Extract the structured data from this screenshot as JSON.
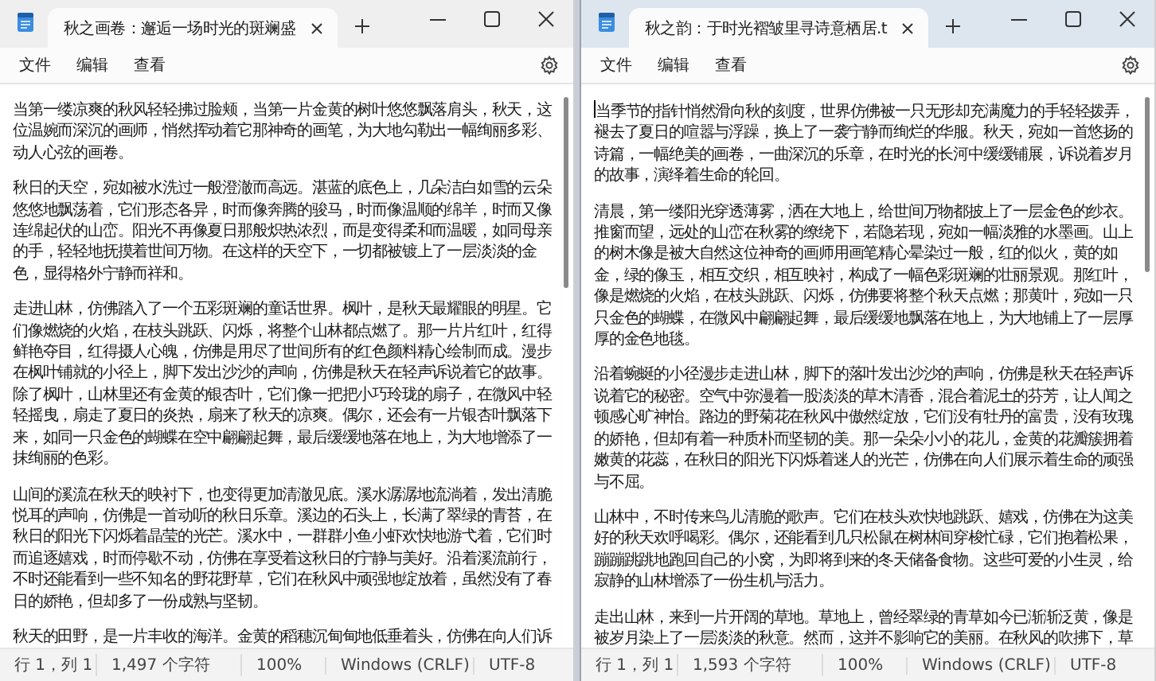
{
  "windows": [
    {
      "focused": false,
      "tab": {
        "title": "秋之画卷：邂逅一场时光的斑斓盛",
        "selected": true
      },
      "menu": [
        "文件",
        "编辑",
        "查看"
      ],
      "paragraphs": [
        "当第一缕凉爽的秋风轻轻拂过脸颊，当第一片金黄的树叶悠悠飘落肩头，秋天，这位温婉而深沉的画师，悄然挥动着它那神奇的画笔，为大地勾勒出一幅绚丽多彩、动人心弦的画卷。",
        "秋日的天空，宛如被水洗过一般澄澈而高远。湛蓝的底色上，几朵洁白如雪的云朵悠悠地飘荡着，它们形态各异，时而像奔腾的骏马，时而像温顺的绵羊，时而又像连绵起伏的山峦。阳光不再像夏日那般炽热浓烈，而是变得柔和而温暖，如同母亲的手，轻轻地抚摸着世间万物。在这样的天空下，一切都被镀上了一层淡淡的金色，显得格外宁静而祥和。",
        "走进山林，仿佛踏入了一个五彩斑斓的童话世界。枫叶，是秋天最耀眼的明星。它们像燃烧的火焰，在枝头跳跃、闪烁，将整个山林都点燃了。那一片片红叶，红得鲜艳夺目，红得摄人心魄，仿佛是用尽了世间所有的红色颜料精心绘制而成。漫步在枫叶铺就的小径上，脚下发出沙沙的声响，仿佛是秋天在轻声诉说着它的故事。除了枫叶，山林里还有金黄的银杏叶，它们像一把把小巧玲珑的扇子，在微风中轻轻摇曳，扇走了夏日的炎热，扇来了秋天的凉爽。偶尔，还会有一片银杏叶飘落下来，如同一只金色的蝴蝶在空中翩翩起舞，最后缓缓地落在地上，为大地增添了一抹绚丽的色彩。",
        "山间的溪流在秋天的映衬下，也变得更加清澈见底。溪水潺潺地流淌着，发出清脆悦耳的声响，仿佛是一首动听的秋日乐章。溪边的石头上，长满了翠绿的青苔，在秋日的阳光下闪烁着晶莹的光芒。溪水中，一群群小鱼小虾欢快地游弋着，它们时而追逐嬉戏，时而停歇不动，仿佛在享受着这秋日的宁静与美好。沿着溪流前行，不时还能看到一些不知名的野花野草，它们在秋风中顽强地绽放着，虽然没有了春日的娇艳，但却多了一份成熟与坚韧。",
        "秋天的田野，是一片丰收的海洋。金黄的稻穗沉甸甸地低垂着头，仿佛在向人们诉"
      ],
      "status": {
        "position": "行 1，列 1",
        "characters": "1,497 个字符",
        "zoom": "100%",
        "line_ending": "Windows (CRLF)",
        "encoding": "UTF-8"
      }
    },
    {
      "focused": true,
      "tab": {
        "title": "秋之韵：于时光褶皱里寻诗意栖居.t",
        "selected": true
      },
      "menu": [
        "文件",
        "编辑",
        "查看"
      ],
      "paragraphs": [
        "当季节的指针悄然滑向秋的刻度，世界仿佛被一只无形却充满魔力的手轻轻拨弄，褪去了夏日的喧嚣与浮躁，换上了一袭宁静而绚烂的华服。秋天，宛如一首悠扬的诗篇，一幅绝美的画卷，一曲深沉的乐章，在时光的长河中缓缓铺展，诉说着岁月的故事，演绎着生命的轮回。",
        "清晨，第一缕阳光穿透薄雾，洒在大地上，给世间万物都披上了一层金色的纱衣。推窗而望，远处的山峦在秋雾的缭绕下，若隐若现，宛如一幅淡雅的水墨画。山上的树木像是被大自然这位神奇的画师用画笔精心晕染过一般，红的似火，黄的如金，绿的像玉，相互交织，相互映衬，构成了一幅色彩斑斓的壮丽景观。那红叶，像是燃烧的火焰，在枝头跳跃、闪烁，仿佛要将整个秋天点燃；那黄叶，宛如一只只金色的蝴蝶，在微风中翩翩起舞，最后缓缓地飘落在地上，为大地铺上了一层厚厚的金色地毯。",
        "沿着蜿蜒的小径漫步走进山林，脚下的落叶发出沙沙的声响，仿佛是秋天在轻声诉说着它的秘密。空气中弥漫着一股淡淡的草木清香，混合着泥土的芬芳，让人闻之顿感心旷神怡。路边的野菊花在秋风中傲然绽放，它们没有牡丹的富贵，没有玫瑰的娇艳，但却有着一种质朴而坚韧的美。那一朵朵小小的花儿，金黄的花瓣簇拥着嫩黄的花蕊，在秋日的阳光下闪烁着迷人的光芒，仿佛在向人们展示着生命的顽强与不屈。",
        "山林中，不时传来鸟儿清脆的歌声。它们在枝头欢快地跳跃、嬉戏，仿佛在为这美好的秋天欢呼喝彩。偶尔，还能看到几只松鼠在树林间穿梭忙碌，它们抱着松果，蹦蹦跳跳地跑回自己的小窝，为即将到来的冬天储备食物。这些可爱的小生灵，给寂静的山林增添了一份生机与活力。",
        "走出山林，来到一片开阔的草地。草地上，曾经翠绿的青草如今已渐渐泛黄，像是被岁月染上了一层淡淡的秋意。然而，这并不影响它的美丽。在秋风的吹拂下，草"
      ],
      "status": {
        "position": "行 1，列 1",
        "characters": "1,593 个字符",
        "zoom": "100%",
        "line_ending": "Windows (CRLF)",
        "encoding": "UTF-8"
      }
    }
  ]
}
